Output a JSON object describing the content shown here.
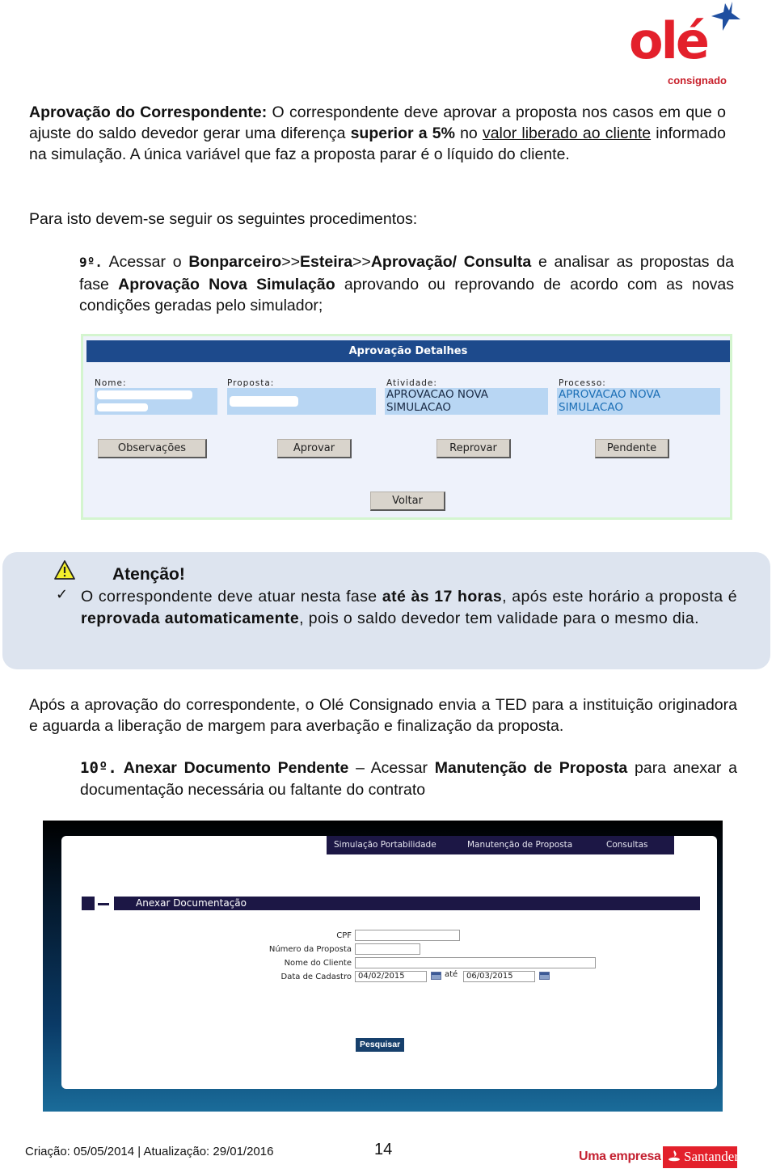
{
  "logo": {
    "brand": "olé",
    "sub": "consignado",
    "star_icon": "star-icon",
    "colors": {
      "red": "#e3202b",
      "blue": "#1f4fa0"
    }
  },
  "intro": {
    "title": "Aprovação do Correspondente:",
    "text_a": " O correspondente deve aprovar a proposta nos casos em que o ajuste do saldo devedor gerar uma diferença ",
    "bold_a": "superior a 5%",
    "text_b": "  no ",
    "underline_a": "valor liberado ao cliente",
    "text_c": " informado na simulação. A única variável que faz a proposta parar é o líquido do cliente."
  },
  "procedures_intro": "Para isto devem-se seguir os seguintes procedimentos:",
  "step9": {
    "number": "9º.",
    "text_a": " Acessar o ",
    "path_1": "Bonparceiro",
    "sep": ">>",
    "path_2": "Esteira",
    "path_3": "Aprovação/ Consulta",
    "text_b": " e analisar as propostas da fase ",
    "phase": "Aprovação Nova Simulação",
    "text_c": " aprovando ou reprovando de acordo com as novas condições geradas pelo simulador;"
  },
  "approval_screen": {
    "title": "Aprovação Detalhes",
    "fields": [
      {
        "label": "Nome:",
        "value": ""
      },
      {
        "label": "Proposta:",
        "value": ""
      },
      {
        "label": "Atividade:",
        "value_line1": "APROVACAO NOVA",
        "value_line2": "SIMULACAO"
      },
      {
        "label": "Processo:",
        "value_line1": "APROVACAO NOVA",
        "value_line2": "SIMULACAO"
      }
    ],
    "buttons": {
      "observacoes": "Observações",
      "aprovar": "Aprovar",
      "reprovar": "Reprovar",
      "pendente": "Pendente",
      "voltar": "Voltar"
    }
  },
  "attention": {
    "icon": "warning-icon",
    "title": "Atenção!",
    "check": "✓",
    "text_a": "O correspondente deve atuar nesta fase ",
    "bold_a": "até às 17 horas",
    "text_b": ", após este horário a proposta é ",
    "bold_b": "reprovada automaticamente",
    "text_c": ", pois o saldo devedor tem validade para o mesmo dia."
  },
  "after_approval": "Após a aprovação do correspondente, o Olé Consignado envia a TED para a instituição originadora e aguarda a liberação de margem para averbação e finalização da proposta.",
  "step10": {
    "number": "10º.",
    "title": " Anexar Documento Pendente",
    "dash": " – ",
    "text_a": "Acessar ",
    "bold_a": "Manutenção de Proposta",
    "text_b": " para anexar a documentação necessária ou faltante do contrato"
  },
  "attach_screen": {
    "nav": [
      "Simulação Portabilidade",
      "Manutenção de Proposta",
      "Consultas"
    ],
    "section_title": "Anexar Documentação",
    "form": {
      "cpf_label": "CPF",
      "cpf_value": "",
      "proposta_label": "Número da Proposta",
      "proposta_value": "",
      "cliente_label": "Nome do Cliente",
      "cliente_value": "",
      "data_label": "Data de Cadastro",
      "data_from": "04/02/2015",
      "ate_label": "até",
      "data_to": "06/03/2015"
    },
    "search_button": "Pesquisar"
  },
  "footer": {
    "dates": "Criação: 05/05/2014 | Atualização: 29/01/2016",
    "page": "14",
    "company_prefix": "Uma empresa",
    "company": "Santander"
  }
}
